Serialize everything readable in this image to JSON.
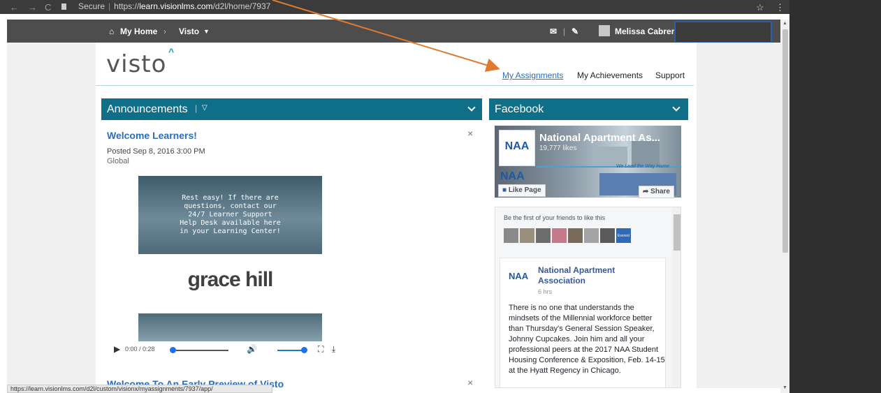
{
  "browser": {
    "back": "←",
    "forward": "→",
    "reload": "C",
    "secure_label": "Secure",
    "url_prefix": "https://",
    "url_host": "learn.visionlms.com",
    "url_path": "/d2l/home/7937",
    "star": "☆",
    "menu": "⋮"
  },
  "topnav": {
    "home_label": "My Home",
    "breadcrumb_sep": "›",
    "course_label": "Visto",
    "user_name": "Melissa Cabrera"
  },
  "header": {
    "logo": "visto",
    "logo_mark": "^",
    "links": [
      "My Assignments",
      "My Achievements",
      "Support"
    ]
  },
  "announcements": {
    "title": "Announcements",
    "items": [
      {
        "title": "Welcome Learners!",
        "posted": "Posted Sep 8, 2016 3:00 PM",
        "scope": "Global",
        "banner_text": "Rest easy! If there are\nquestions, contact our\n24/7 Learner Support\nHelp Desk available here\nin your Learning Center!",
        "brand": "grace hill",
        "player_time": "0:00 / 0:28"
      },
      {
        "title": "Welcome To An Early Preview of Visto"
      }
    ]
  },
  "facebook": {
    "title": "Facebook",
    "page_name": "National Apartment As...",
    "likes": "19,777 likes",
    "tagline": "We Lead the Way Home",
    "logo_text": "NAA",
    "like_button": "Like Page",
    "share_button": "Share",
    "friends_text": "Be the first of your friends to like this",
    "friend_badge": "Everest",
    "post": {
      "author": "National Apartment Association",
      "time": "6 hrs",
      "text": "There is no one that understands the mindsets of the Millennial workforce better than Thursday's General Session Speaker, Johnny Cupcakes. Join him and all your professional peers at the 2017 NAA Student Housing Conference & Exposition, Feb. 14-15 at the Hyatt Regency in Chicago."
    }
  },
  "status_bar": {
    "url": "https://learn.visionlms.com/d2l/custom/visionx/myassignments/7937/app/"
  },
  "colors": {
    "accent": "#0f6f88",
    "link": "#2a6ebb",
    "annotation_arrow": "#e07a2e"
  }
}
